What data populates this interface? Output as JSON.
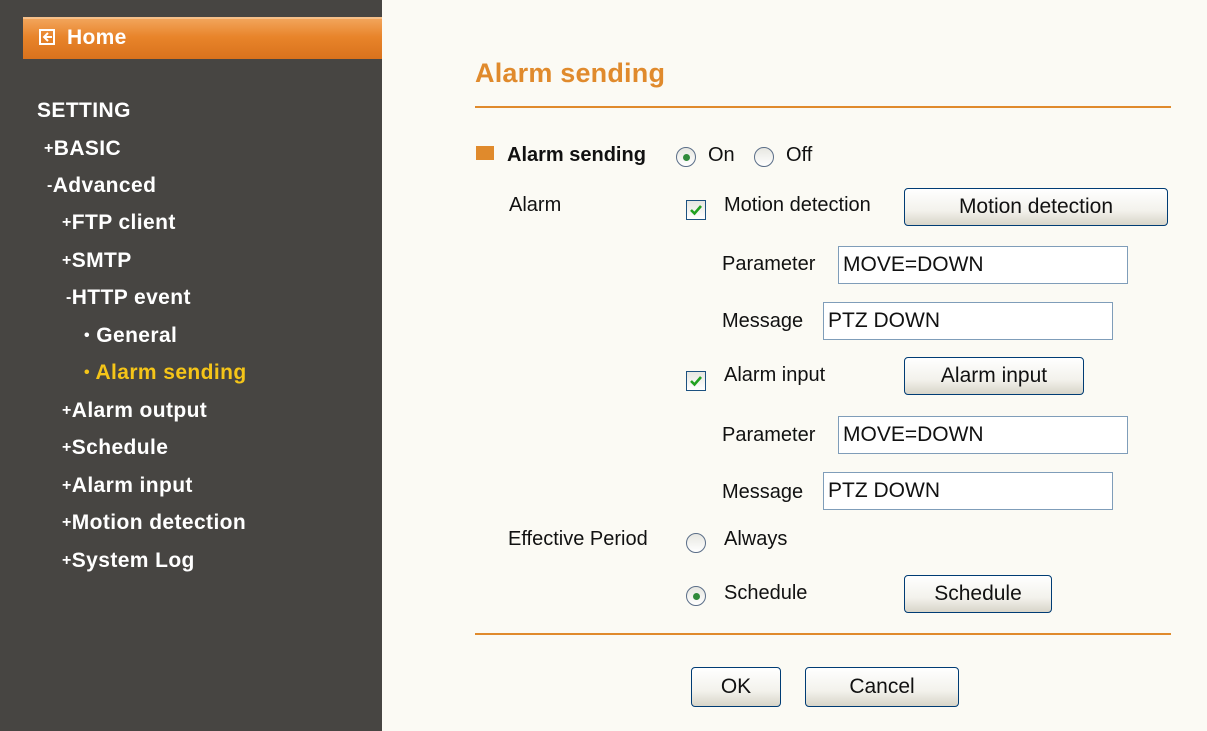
{
  "sidebar": {
    "home_label": "Home",
    "items": [
      {
        "label": "SETTING",
        "mark": ""
      },
      {
        "label": "BASIC",
        "mark": "+"
      },
      {
        "label": "Advanced",
        "mark": "-"
      },
      {
        "label": "FTP client",
        "mark": "+"
      },
      {
        "label": "SMTP",
        "mark": "+"
      },
      {
        "label": "HTTP event",
        "mark": "-"
      },
      {
        "label": "General",
        "mark": "•"
      },
      {
        "label": "Alarm sending",
        "mark": "•"
      },
      {
        "label": "Alarm output",
        "mark": "+"
      },
      {
        "label": "Schedule",
        "mark": "+"
      },
      {
        "label": "Alarm input",
        "mark": "+"
      },
      {
        "label": "Motion detection",
        "mark": "+"
      },
      {
        "label": "System Log",
        "mark": "+"
      }
    ]
  },
  "main": {
    "title": "Alarm sending",
    "section_label": "Alarm sending",
    "on_label": "On",
    "off_label": "Off",
    "alarm_label": "Alarm",
    "motion": {
      "checkbox_label": "Motion detection",
      "button_label": "Motion detection",
      "parameter_label": "Parameter",
      "parameter_value": "MOVE=DOWN",
      "message_label": "Message",
      "message_value": "PTZ DOWN"
    },
    "alarm_input": {
      "checkbox_label": "Alarm input",
      "button_label": "Alarm input",
      "parameter_label": "Parameter",
      "parameter_value": "MOVE=DOWN",
      "message_label": "Message",
      "message_value": "PTZ DOWN"
    },
    "effective_period_label": "Effective Period",
    "always_label": "Always",
    "schedule_label": "Schedule",
    "schedule_button_label": "Schedule",
    "ok_label": "OK",
    "cancel_label": "Cancel"
  },
  "colors": {
    "sidebar_bg": "#474542",
    "accent": "#e08a2c",
    "active_nav": "#f5c518"
  }
}
